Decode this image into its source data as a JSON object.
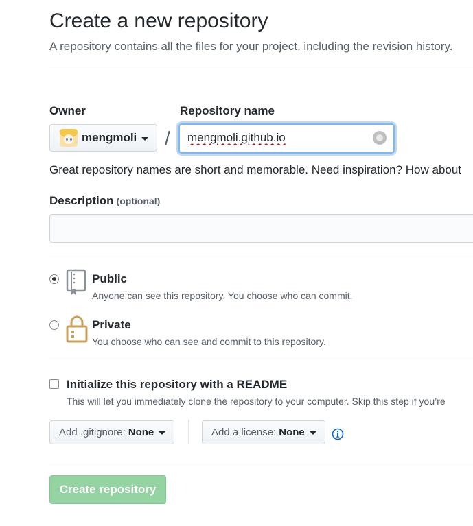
{
  "header": {
    "title": "Create a new repository",
    "subtitle": "A repository contains all the files for your project, including the revision history."
  },
  "owner": {
    "label": "Owner",
    "value": "mengmoli"
  },
  "repo_name": {
    "label": "Repository name",
    "value": "mengmoli.github.io",
    "separator": "/"
  },
  "hint": "Great repository names are short and memorable. Need inspiration? How about",
  "description": {
    "label": "Description",
    "optional": "(optional)",
    "value": ""
  },
  "visibility": {
    "public": {
      "title": "Public",
      "desc": "Anyone can see this repository. You choose who can commit.",
      "selected": true
    },
    "private": {
      "title": "Private",
      "desc": "You choose who can see and commit to this repository.",
      "selected": false
    }
  },
  "init": {
    "title": "Initialize this repository with a README",
    "desc": "This will let you immediately clone the repository to your computer. Skip this step if you’re",
    "checked": false
  },
  "gitignore": {
    "label": "Add .gitignore:",
    "value": "None"
  },
  "license": {
    "label": "Add a license:",
    "value": "None"
  },
  "submit": {
    "label": "Create repository"
  },
  "colors": {
    "accent_blue": "#0366d6",
    "create_disabled": "#94d3a2",
    "focus_border": "#79b8ff"
  },
  "icons": {
    "public": "repo-book-icon",
    "private": "lock-icon",
    "info": "info-icon"
  }
}
